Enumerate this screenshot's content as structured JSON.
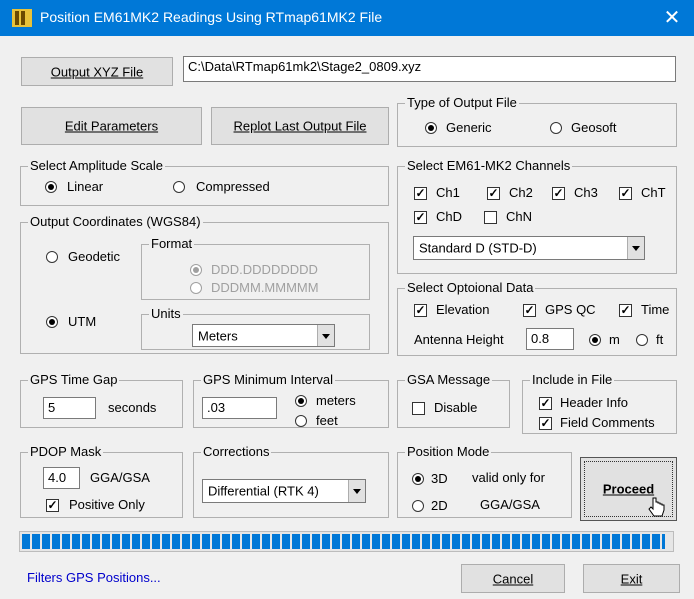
{
  "window": {
    "title": "Position EM61MK2 Readings Using RTmap61MK2 File",
    "close_glyph": "✕"
  },
  "output_xyz": {
    "button_label": "Output XYZ File",
    "path_value": "C:\\Data\\RTmap61mk2\\Stage2_0809.xyz"
  },
  "buttons": {
    "edit_parameters": "Edit Parameters",
    "replot": "Replot Last Output File",
    "proceed": "Proceed",
    "cancel": "Cancel",
    "exit": "Exit"
  },
  "output_type": {
    "title": "Type of Output File",
    "options": [
      "Generic",
      "Geosoft"
    ],
    "selected": "Generic"
  },
  "amplitude": {
    "title": "Select Amplitude Scale",
    "options": [
      "Linear",
      "Compressed"
    ],
    "selected": "Linear"
  },
  "channels": {
    "title": "Select EM61-MK2 Channels",
    "items": [
      {
        "label": "Ch1",
        "checked": true
      },
      {
        "label": "Ch2",
        "checked": true
      },
      {
        "label": "Ch3",
        "checked": true
      },
      {
        "label": "ChT",
        "checked": true
      },
      {
        "label": "ChD",
        "checked": true
      },
      {
        "label": "ChN",
        "checked": false
      }
    ],
    "mode_value": "Standard D  (STD-D)"
  },
  "coordinates": {
    "title": "Output Coordinates (WGS84)",
    "geodetic": "Geodetic",
    "utm": "UTM",
    "selected": "UTM",
    "format_title": "Format",
    "format_options": [
      "DDD.DDDDDDDD",
      "DDDMM.MMMMM"
    ],
    "format_selected": "DDD.DDDDDDDD",
    "units_title": "Units",
    "units_value": "Meters"
  },
  "optional": {
    "title": "Select Optoional Data",
    "elevation": "Elevation",
    "gps_qc": "GPS QC",
    "time": "Time",
    "antenna_label": "Antenna Height",
    "antenna_value": "0.8",
    "unit_m": "m",
    "unit_ft": "ft",
    "unit_selected": "m"
  },
  "gps_gap": {
    "title": "GPS Time Gap",
    "value": "5",
    "unit": "seconds"
  },
  "gps_min": {
    "title": "GPS Minimum Interval",
    "value": ".03",
    "options": [
      "meters",
      "feet"
    ],
    "selected": "meters"
  },
  "gsa": {
    "title": "GSA Message",
    "disable_label": "Disable",
    "checked": false
  },
  "include": {
    "title": "Include in File",
    "header": "Header Info",
    "comments": "Field Comments"
  },
  "pdop": {
    "title": "PDOP Mask",
    "value": "4.0",
    "label": "GGA/GSA",
    "positive_only": "Positive Only"
  },
  "corrections": {
    "title": "Corrections",
    "value": "Differential (RTK 4)"
  },
  "position_mode": {
    "title": "Position Mode",
    "options": [
      "3D",
      "2D"
    ],
    "selected": "3D",
    "note_line1": "valid only for",
    "note_line2": "GGA/GSA"
  },
  "progress": {
    "percent": 99
  },
  "status_link": "Filters GPS Positions...",
  "check_glyph": "✓"
}
